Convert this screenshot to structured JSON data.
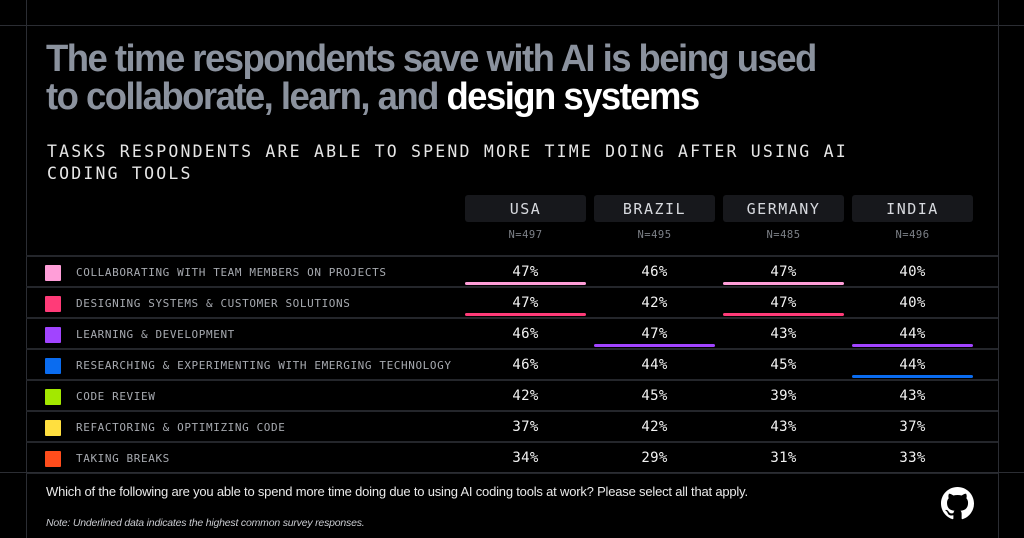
{
  "header": {
    "title_part1": "The time respondents save with AI is being used",
    "title_part2": "to collaborate, learn, and ",
    "title_highlight": "design systems",
    "subtitle": "TASKS RESPONDENTS ARE ABLE TO SPEND MORE TIME DOING AFTER USING AI CODING TOOLS"
  },
  "footer": {
    "question": "Which of the following are you able to spend more time doing due to using AI coding tools at work? Please select all that apply.",
    "note": "Note: Underlined data indicates the highest common survey responses.",
    "logo_icon": "github-icon"
  },
  "chart_data": {
    "type": "table",
    "title": "The time respondents save with AI is being used to collaborate, learn, and design systems",
    "subtitle": "TASKS RESPONDENTS ARE ABLE TO SPEND MORE TIME DOING AFTER USING AI CODING TOOLS",
    "columns": [
      {
        "label": "USA",
        "n": "N=497"
      },
      {
        "label": "BRAZIL",
        "n": "N=495"
      },
      {
        "label": "GERMANY",
        "n": "N=485"
      },
      {
        "label": "INDIA",
        "n": "N=496"
      }
    ],
    "rows": [
      {
        "label": "COLLABORATING WITH TEAM MEMBERS ON PROJECTS",
        "color": "#ff9ed8",
        "values": [
          "47%",
          "46%",
          "47%",
          "40%"
        ],
        "underlined": [
          true,
          false,
          true,
          false
        ]
      },
      {
        "label": "DESIGNING SYSTEMS & CUSTOMER SOLUTIONS",
        "color": "#ff3b78",
        "values": [
          "47%",
          "42%",
          "47%",
          "40%"
        ],
        "underlined": [
          true,
          false,
          true,
          false
        ]
      },
      {
        "label": "LEARNING & DEVELOPMENT",
        "color": "#a144ff",
        "values": [
          "46%",
          "47%",
          "43%",
          "44%"
        ],
        "underlined": [
          false,
          true,
          false,
          true
        ]
      },
      {
        "label": "RESEARCHING & EXPERIMENTING WITH EMERGING TECHNOLOGY",
        "color": "#0a6cf0",
        "values": [
          "46%",
          "44%",
          "45%",
          "44%"
        ],
        "underlined": [
          false,
          false,
          false,
          true
        ]
      },
      {
        "label": "CODE REVIEW",
        "color": "#a3e800",
        "values": [
          "42%",
          "45%",
          "39%",
          "43%"
        ],
        "underlined": [
          false,
          false,
          false,
          false
        ]
      },
      {
        "label": "REFACTORING & OPTIMIZING CODE",
        "color": "#ffdf3f",
        "values": [
          "37%",
          "42%",
          "43%",
          "37%"
        ],
        "underlined": [
          false,
          false,
          false,
          false
        ]
      },
      {
        "label": "TAKING BREAKS",
        "color": "#ff4d1c",
        "values": [
          "34%",
          "29%",
          "31%",
          "33%"
        ],
        "underlined": [
          false,
          false,
          false,
          false
        ]
      }
    ]
  }
}
